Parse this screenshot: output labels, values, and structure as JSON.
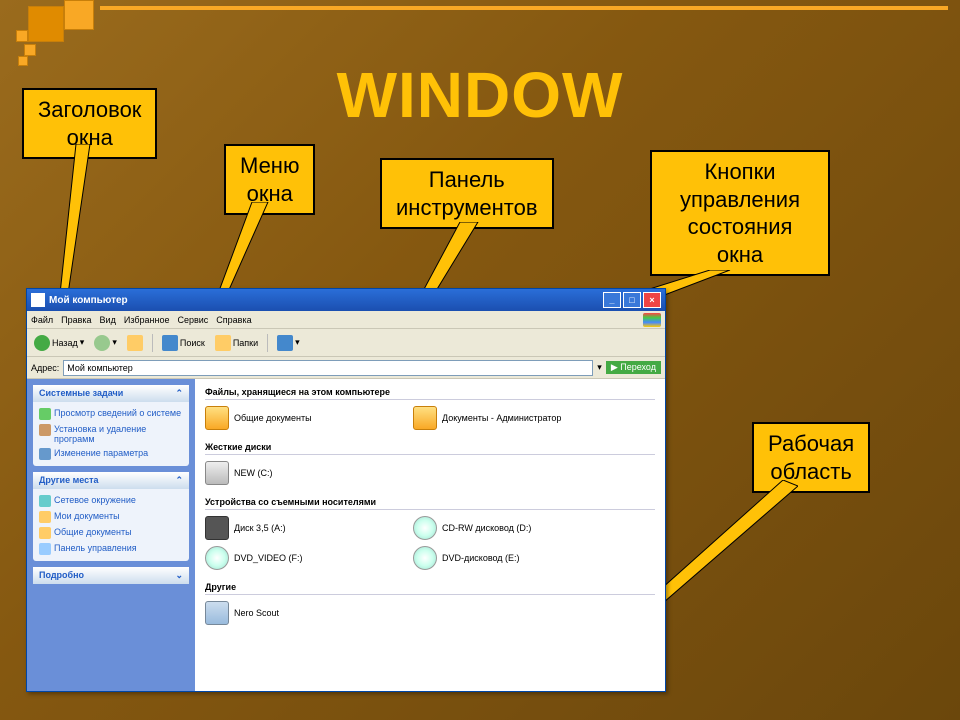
{
  "title_main": "WINDOW",
  "callouts": {
    "title": {
      "l1": "Заголовок",
      "l2": "окна"
    },
    "menu": {
      "l1": "Меню",
      "l2": "окна"
    },
    "toolbar": {
      "l1": "Панель",
      "l2": "инструментов"
    },
    "ctrls": {
      "l1": "Кнопки",
      "l2": "управления",
      "l3": "состояния",
      "l4": "окна"
    },
    "workarea": {
      "l1": "Рабочая",
      "l2": "область"
    }
  },
  "window": {
    "title": "Мой компьютер",
    "menu": [
      "Файл",
      "Правка",
      "Вид",
      "Избранное",
      "Сервис",
      "Справка"
    ],
    "toolbar": {
      "back": "Назад",
      "search": "Поиск",
      "folders": "Папки"
    },
    "address": {
      "label": "Адрес:",
      "value": "Мой компьютер",
      "go": "Переход"
    },
    "side": {
      "panel1": {
        "head": "Системные задачи",
        "items": [
          "Просмотр сведений о системе",
          "Установка и удаление программ",
          "Изменение параметра"
        ]
      },
      "panel2": {
        "head": "Другие места",
        "items": [
          "Сетевое окружение",
          "Мои документы",
          "Общие документы",
          "Панель управления"
        ]
      },
      "panel3": {
        "head": "Подробно"
      }
    },
    "groups": [
      {
        "head": "Файлы, хранящиеся на этом компьютере",
        "items": [
          {
            "icon": "folder",
            "label": "Общие документы"
          },
          {
            "icon": "folder",
            "label": "Документы - Администратор"
          }
        ]
      },
      {
        "head": "Жесткие диски",
        "items": [
          {
            "icon": "hdd",
            "label": "NEW (C:)"
          }
        ]
      },
      {
        "head": "Устройства со съемными носителями",
        "items": [
          {
            "icon": "floppy",
            "label": "Диск 3,5 (A:)"
          },
          {
            "icon": "cd",
            "label": "CD-RW дисковод (D:)"
          },
          {
            "icon": "cd",
            "label": "DVD_VIDEO (F:)"
          },
          {
            "icon": "cd",
            "label": "DVD-дисковод (E:)"
          }
        ]
      },
      {
        "head": "Другие",
        "items": [
          {
            "icon": "tool",
            "label": "Nero Scout"
          }
        ]
      }
    ]
  }
}
